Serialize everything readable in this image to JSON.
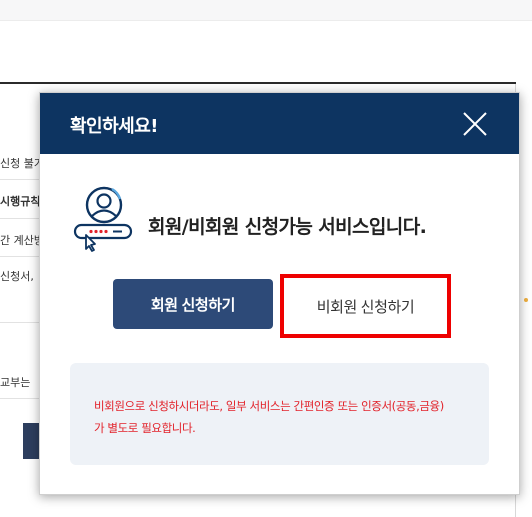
{
  "background": {
    "rows": [
      {
        "text": "신청 불가",
        "bold": false
      },
      {
        "text": "시행규칙",
        "bold": true
      },
      {
        "text": "간 계산방",
        "bold": false
      },
      {
        "text": "신청서,",
        "bold": false
      },
      {
        "text": "교부는",
        "bold": false
      }
    ]
  },
  "modal": {
    "title": "확인하세요!",
    "close_icon": "close-icon",
    "hero_icon": "user-password-icon",
    "message": "회원/비회원 신청가능 서비스입니다.",
    "member_button": "회원 신청하기",
    "nonmember_button": "비회원 신청하기",
    "notice_line1": "비회원으로 신청하시더라도, 일부 서비스는 간편인증 또는 인증서(공동,금융)",
    "notice_line2": "가 별도로 필요합니다."
  },
  "colors": {
    "header": "#0d3461",
    "member_button": "#2d4a78",
    "highlight": "#ee0000",
    "notice_text": "#e2222a",
    "notice_bg": "#eef2f7"
  }
}
